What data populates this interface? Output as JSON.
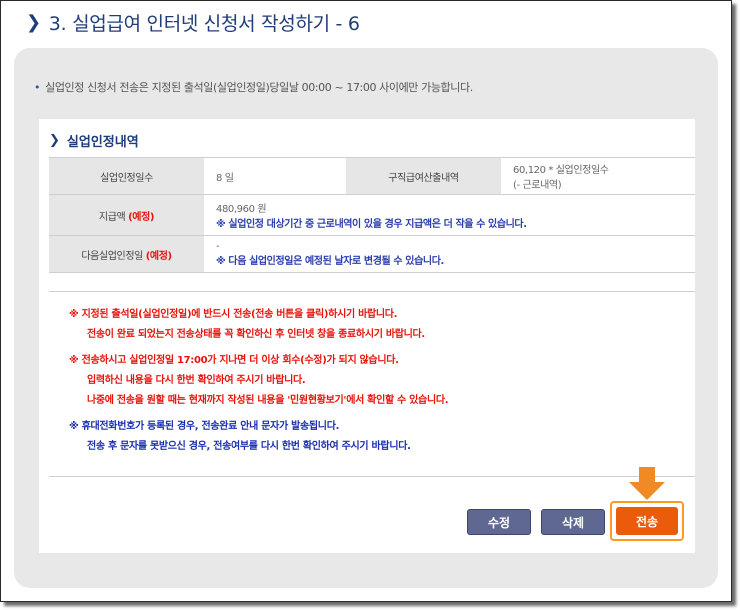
{
  "page": {
    "heading": "3. 실업급여 인터넷 신청서 작성하기 - 6",
    "notice": "실업인정 신청서 전송은 지정된 출석일(실업인정일)당일날 00:00 ~ 17:00 사이에만 가능합니다."
  },
  "card": {
    "title": "실업인정내역",
    "rows": [
      {
        "label1": "실업인정일수",
        "value1": "8 일",
        "label2": "구직급여산출내역",
        "value2_line1": "60,120 * 실업인정일수",
        "value2_line2": "(- 근로내역)"
      },
      {
        "label": "지급액",
        "label_tag": "(예정)",
        "value_line1": "480,960 원",
        "value_line2": "※ 실업인정 대상기간 중 근로내역이 있을 경우 지급액은 더 작을 수 있습니다."
      },
      {
        "label": "다음실업인정일",
        "label_tag": "(예정)",
        "value_line1": "-",
        "value_line2": "※ 다음 실업인정일은 예정된 날자로 변경될 수 있습니다."
      }
    ],
    "messages": {
      "group1": [
        "※ 지정된 출석일(실업인정일)에 반드시 전송(전송 버튼을 클릭)하시기 바랍니다.",
        "전송이 완료 되었는지 전송상태를 꼭 확인하신 후 인터넷 창을 종료하시기 바랍니다."
      ],
      "group2": [
        "※ 전송하시고 실업인정일 17:00가 지나면 더 이상 회수(수정)가 되지 않습니다.",
        "입력하신 내용을 다시 한번 확인하여 주시기 바랍니다.",
        "나중에 전송을 원할 때는 현재까지 작성된 내용을 '민원현황보기'에서 확인할 수 있습니다."
      ],
      "group3": [
        "※ 휴대전화번호가 등록된 경우, 전송완료 안내 문자가 발송됩니다.",
        "전송 후 문자를 못받으신 경우, 전송여부를 다시 한번 확인하여 주시기 바랍니다."
      ]
    },
    "buttons": {
      "edit": "수정",
      "delete": "삭제",
      "send": "전송"
    }
  },
  "colors": {
    "heading": "#1f3d7a",
    "warning_red": "#e8140c",
    "info_blue": "#1a2fb0",
    "button_gray_blue": "#5f6891",
    "send_orange": "#ea5b0c",
    "highlight_orange": "#ff9a1f"
  },
  "icons": {
    "heading_bullet": "chevron-right-icon",
    "highlight_pointer": "arrow-down-icon"
  }
}
